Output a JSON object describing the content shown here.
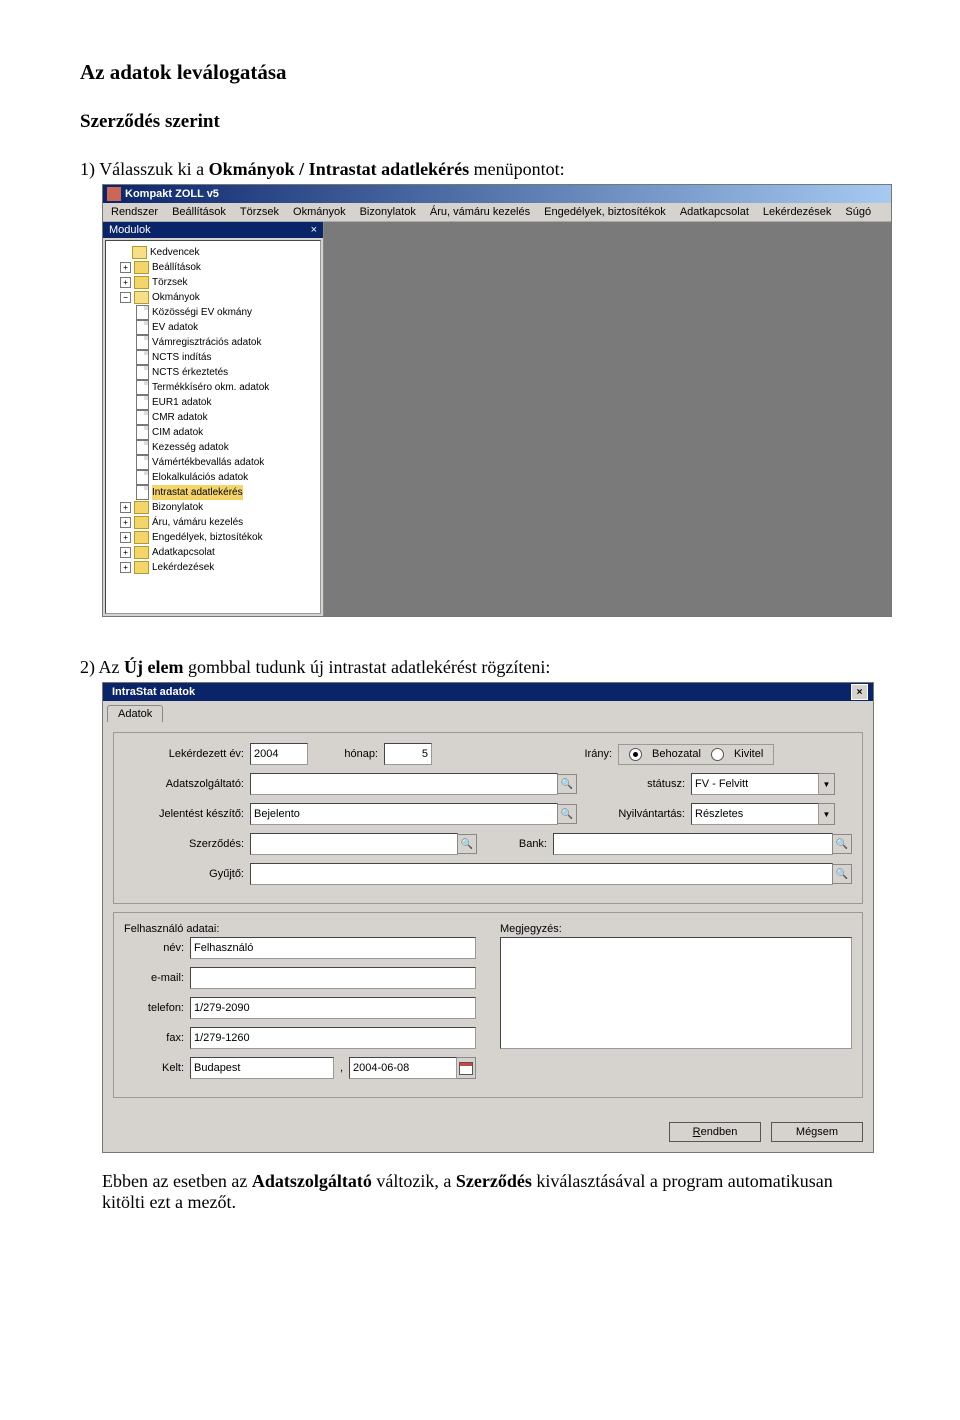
{
  "doc": {
    "title": "Az adatok leválogatása",
    "subtitle": "Szerződés szerint",
    "step1_prefix": "1)",
    "step1_a": "Válasszuk ki a ",
    "step1_b": "Okmányok / Intrastat adatlekérés",
    "step1_c": " menüpontot:",
    "step2_prefix": "2)",
    "step2_a": "Az ",
    "step2_b": "Új elem",
    "step2_c": " gombbal tudunk új intrastat adatlekérést rögzíteni:",
    "closing_a": "Ebben az esetben az ",
    "closing_b": "Adatszolgáltató",
    "closing_c": " változik, a ",
    "closing_d": "Szerződés",
    "closing_e": " kiválasztásával a program automatikusan kitölti ezt a mezőt."
  },
  "app": {
    "title": "Kompakt ZOLL v5",
    "menu": [
      "Rendszer",
      "Beállítások",
      "Törzsek",
      "Okmányok",
      "Bizonylatok",
      "Áru, vámáru kezelés",
      "Engedélyek, biztosítékok",
      "Adatkapcsolat",
      "Lekérdezések",
      "Súgó"
    ],
    "panel_title": "Modulok",
    "panel_close": "×",
    "tree": {
      "kedvencek": "Kedvencek",
      "beallitasok": "Beállítások",
      "torzsek": "Törzsek",
      "okmanyok": "Okmányok",
      "okmanyok_children": [
        "Közösségi EV okmány",
        "EV adatok",
        "Vámregisztrációs adatok",
        "NCTS indítás",
        "NCTS érkeztetés",
        "Termékkíséro okm. adatok",
        "EUR1 adatok",
        "CMR adatok",
        "CIM adatok",
        "Kezesség adatok",
        "Vámértékbevallás adatok",
        "Elokalkulációs adatok",
        "Intrastat adatlekérés"
      ],
      "bizonylatok": "Bizonylatok",
      "aru": "Áru, vámáru kezelés",
      "engedelyek": "Engedélyek, biztosítékok",
      "adatkapcsolat": "Adatkapcsolat",
      "lekerdezesek": "Lekérdezések"
    }
  },
  "dialog": {
    "title": "IntraStat adatok",
    "tab": "Adatok",
    "close": "×",
    "labels": {
      "year": "Lekérdezett év:",
      "month": "hónap:",
      "direction": "Irány:",
      "provider": "Adatszolgáltató:",
      "status": "státusz:",
      "reporter": "Jelentést készítő:",
      "registry": "Nyilvántartás:",
      "contract": "Szerződés:",
      "bank": "Bank:",
      "collector": "Gyűjtő:",
      "user_section": "Felhasználó adatai:",
      "note": "Megjegyzés:",
      "name": "név:",
      "email": "e-mail:",
      "phone": "telefon:",
      "fax": "fax:",
      "date": "Kelt:"
    },
    "values": {
      "year": "2004",
      "month": "5",
      "radio_in": "Behozatal",
      "radio_out": "Kivitel",
      "status": "FV - Felvitt",
      "reporter": "Bejelento",
      "registry": "Részletes",
      "name": "Felhasználó",
      "email": "",
      "phone": "1/279-2090",
      "fax": "1/279-1260",
      "city": "Budapest",
      "sep": ",",
      "date": "2004-06-08"
    },
    "buttons": {
      "ok_u": "R",
      "ok_rest": "endben",
      "cancel": "Mégsem"
    }
  }
}
